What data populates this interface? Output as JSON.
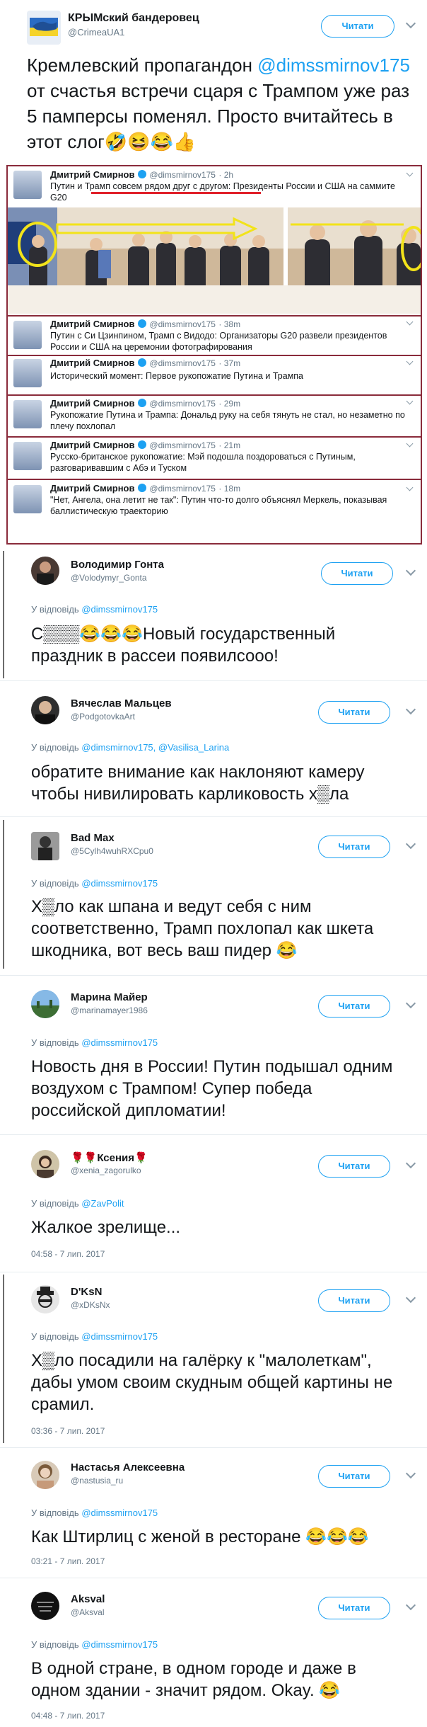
{
  "main_tweet": {
    "name": "КРЫМский бандеровец",
    "handle": "@CrimeaUA1",
    "follow_label": "Читати",
    "text_before": "Кремлевский пропагандон ",
    "mention": "@dimssmirnov175",
    "text_after": " от счастья встречи сцаря с Трампом уже раз 5 памперсы поменял. Просто вчитайтесь в этот слог",
    "emojis": "🤣😆😂👍"
  },
  "embedded": {
    "tweets": [
      {
        "name": "Дмитрий Смирнов",
        "handle": "@dimsmirnov175",
        "time": "· 2h",
        "text": "Путин и Трамп совсем рядом друг с другом: Президенты России и США на саммите G20"
      },
      {
        "name": "Дмитрий Смирнов",
        "handle": "@dimsmirnov175",
        "time": "· 38m",
        "text": "Путин с Си Цзинпином, Трамп с Видодо: Организаторы G20 развели президентов России и США на церемонии фотографирования"
      },
      {
        "name": "Дмитрий Смирнов",
        "handle": "@dimsmirnov175",
        "time": "· 37m",
        "text": "Исторический момент: Первое рукопожатие Путина и Трампа"
      },
      {
        "name": "Дмитрий Смирнов",
        "handle": "@dimsmirnov175",
        "time": "· 29m",
        "text": "Рукопожатие Путина и Трампа: Дональд руку на себя тянуть не стал, но незаметно по плечу похлопал"
      },
      {
        "name": "Дмитрий Смирнов",
        "handle": "@dimsmirnov175",
        "time": "· 21m",
        "text": "Русско-британское рукопожатие: Мэй подошла поздороваться с Путиным, разговаривавшим с Абэ и Туском"
      },
      {
        "name": "Дмитрий Смирнов",
        "handle": "@dimsmirnov175",
        "time": "· 18m",
        "text": "\"Нет, Ангела, она летит не так\": Путин что-то долго объяснял Меркель, показывая баллистическую траекторию"
      }
    ]
  },
  "replies": [
    {
      "name": "Володимир Гонта",
      "handle": "@Volodymyr_Gonta",
      "reply_prefix": "У відповідь",
      "reply_to": "@dimssmirnov175",
      "follow_label": "Читати",
      "text": "С▒▒▒😂😂😂Новый государственный праздник в рассеи появилсоoo!",
      "time": ""
    },
    {
      "name": "Вячеслав Мальцев",
      "handle": "@PodgotovkaArt",
      "reply_prefix": "У відповідь",
      "reply_to": "@dimsmirnov175, @Vasilisa_Larina",
      "follow_label": "Читати",
      "text": "обратите внимание как наклоняют камеру чтобы нивилировать карликовость  х▒ла",
      "time": ""
    },
    {
      "name": "Bad Max",
      "handle": "@5Cylh4wuhRXCpu0",
      "reply_prefix": "У відповідь",
      "reply_to": "@dimssmirnov175",
      "follow_label": "Читати",
      "text": "Х▒ло как шпана и ведут себя с ним соответственно, Трамп похлопал как шкета шкодника, вот весь ваш пидер 😂",
      "time": ""
    },
    {
      "name": "Марина Майер",
      "handle": "@marinamayer1986",
      "reply_prefix": "У відповідь",
      "reply_to": "@dimssmirnov175",
      "follow_label": "Читати",
      "text": "Новость дня в России! Путин подышал одним воздухом с Трампом! Супер победа российской дипломатии!",
      "time": ""
    },
    {
      "name": "🌹🌹Ксения🌹",
      "handle": "@xenia_zagorulko",
      "reply_prefix": "У відповідь",
      "reply_to": "@ZavPolit",
      "follow_label": "Читати",
      "text": "Жалкое зрелище...",
      "time": "04:58 - 7 лип. 2017"
    },
    {
      "name": "D'KsN",
      "handle": "@xDKsNx",
      "reply_prefix": "У відповідь",
      "reply_to": "@dimssmirnov175",
      "follow_label": "Читати",
      "text": "Х▒ло посадили на галёрку к \"малолеткам\", дабы умом своим скудным общей картины не срамил.",
      "time": "03:36 - 7 лип. 2017"
    },
    {
      "name": "Настасья Алексеевна",
      "handle": "@nastusia_ru",
      "reply_prefix": "У відповідь",
      "reply_to": "@dimssmirnov175",
      "follow_label": "Читати",
      "text": "Как Штирлиц с женой в ресторане 😂😂😂",
      "time": "03:21 - 7 лип. 2017"
    },
    {
      "name": "Aksval",
      "handle": "@Aksval",
      "reply_prefix": "У відповідь",
      "reply_to": "@dimssmirnov175",
      "follow_label": "Читати",
      "text": "В одной стране, в одном городе и даже в одном здании - значит рядом. Okay. 😂",
      "time": "04:48 - 7 лип. 2017"
    }
  ]
}
